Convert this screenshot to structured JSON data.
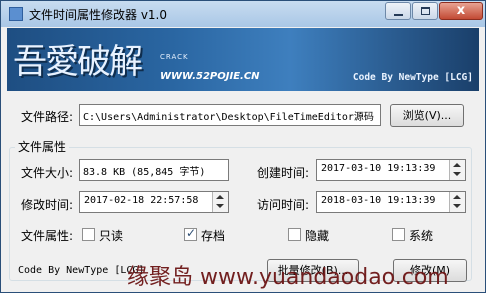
{
  "window": {
    "title": "文件时间属性修改器 v1.0",
    "close_glyph": "x"
  },
  "banner": {
    "logo_text": "吾愛破解",
    "logo_sub": "CRACK",
    "url": "WWW.52POJIE.CN",
    "code_by": "Code By NewType [LCG]"
  },
  "path": {
    "label": "文件路径:",
    "value": "C:\\Users\\Administrator\\Desktop\\FileTimeEditor源码",
    "browse_label": "浏览(V)..."
  },
  "attributes_group": {
    "title": "文件属性",
    "size_label": "文件大小:",
    "size_value": "83.8 KB (85,845 字节)",
    "created_label": "创建时间:",
    "created_value": "2017-03-10 19:13:39",
    "modified_label": "修改时间:",
    "modified_value": "2017-02-18 22:57:58",
    "accessed_label": "访问时间:",
    "accessed_value": "2018-03-10 19:13:39",
    "attr_label": "文件属性:",
    "checkboxes": [
      {
        "label": "只读",
        "checked": false
      },
      {
        "label": "存档",
        "checked": true
      },
      {
        "label": "隐藏",
        "checked": false
      },
      {
        "label": "系统",
        "checked": false
      }
    ]
  },
  "footer": {
    "status_text": "Code By NewType [LCG]",
    "batch_label": "批量修改(B)...",
    "modify_label": "修改(M)"
  },
  "watermark": {
    "text": "缘聚岛 www.yuandaodao.com"
  },
  "colors": {
    "banner_dark": "#1e4e82",
    "banner_light": "#3e7fbe",
    "close_red": "#c24a34",
    "watermark": "#6c1414"
  }
}
